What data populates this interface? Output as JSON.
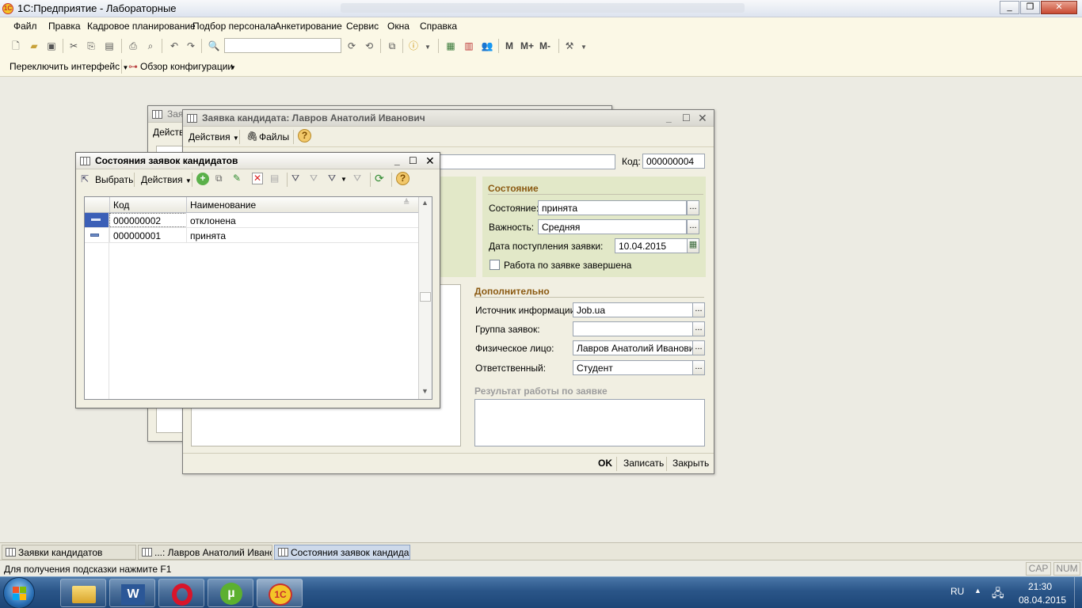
{
  "app": {
    "title": "1С:Предприятие - Лабораторные",
    "logo_text": "1С"
  },
  "menu": [
    "Файл",
    "Правка",
    "Кадровое планирование",
    "Подбор персонала",
    "Анкетирование",
    "Сервис",
    "Окна",
    "Справка"
  ],
  "toolbar2": {
    "switch_interface": "Переключить интерфейс",
    "config_overview": "Обзор конфигурации",
    "m": "M",
    "m_plus": "M+",
    "m_minus": "M-"
  },
  "back_window": {
    "title_fragment": "Зая",
    "actions_fragment": "Действ"
  },
  "candidate_window": {
    "title": "Заявка кандидата: Лавров Анатолий Иванович",
    "actions": "Действия",
    "files": "Файлы",
    "code_label": "Код:",
    "code_value": "000000004",
    "state_section": "Состояние",
    "state_label": "Состояние:",
    "state_value": "принята",
    "importance_label": "Важность:",
    "importance_value": "Средняя",
    "date_label": "Дата поступления заявки:",
    "date_value": "10.04.2015",
    "done_label": "Работа по заявке завершена",
    "extra_section": "Дополнительно",
    "source_label": "Источник информации:",
    "source_value": "Job.ua",
    "group_label": "Группа заявок:",
    "group_value": "",
    "person_label": "Физическое лицо:",
    "person_value": "Лавров Анатолий Иванович",
    "responsible_label": "Ответственный:",
    "responsible_value": "Студент",
    "result_section": "Результат работы по заявке",
    "ok": "OK",
    "save": "Записать",
    "close": "Закрыть"
  },
  "states_window": {
    "title": "Состояния заявок кандидатов",
    "select": "Выбрать",
    "actions": "Действия",
    "columns": [
      "Код",
      "Наименование"
    ],
    "rows": [
      {
        "code": "000000002",
        "name": "отклонена"
      },
      {
        "code": "000000001",
        "name": "принята"
      }
    ]
  },
  "taskbar": [
    {
      "label": "Заявки кандидатов",
      "active": false
    },
    {
      "label": "...: Лавров Анатолий Ивано...",
      "active": false
    },
    {
      "label": "Состояния заявок кандида...",
      "active": true
    }
  ],
  "status": {
    "hint": "Для получения подсказки нажмите F1",
    "cap": "CAP",
    "num": "NUM"
  },
  "os_taskbar": {
    "lang": "RU",
    "time": "21:30",
    "date": "08.04.2015"
  },
  "colors": {
    "section_heading": "#8b5a12",
    "state_panel": "#e2e8c8",
    "os_taskbar": "#2a5588"
  }
}
